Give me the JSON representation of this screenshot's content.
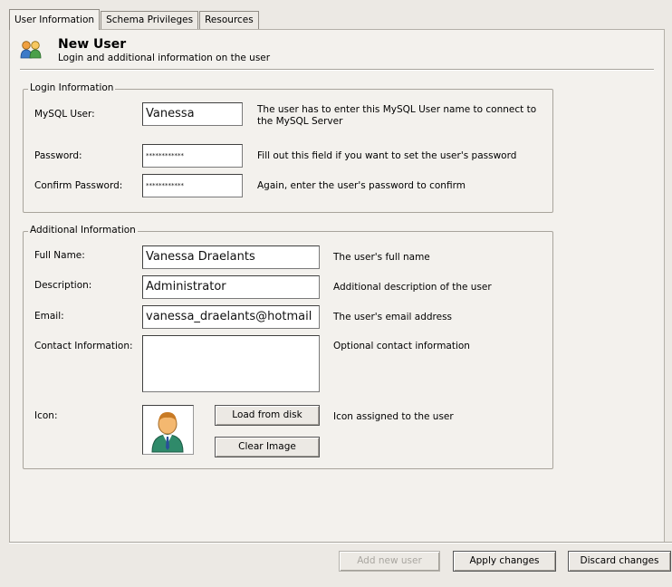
{
  "tabs": [
    {
      "label": "User Information"
    },
    {
      "label": "Schema Privileges"
    },
    {
      "label": "Resources"
    }
  ],
  "header": {
    "icon": "users-icon",
    "title": "New User",
    "subtitle": "Login and additional information on the user"
  },
  "login_group": {
    "title": "Login Information",
    "mysql_user": {
      "label": "MySQL User:",
      "value": "Vanessa",
      "hint": "The user has to enter this MySQL User name to connect to the MySQL Server"
    },
    "password": {
      "label": "Password:",
      "value": "************",
      "hint": "Fill out this field if you want to set the user's password"
    },
    "confirm_password": {
      "label": "Confirm Password:",
      "value": "************",
      "hint": "Again, enter the user's password to confirm"
    }
  },
  "additional_group": {
    "title": "Additional Information",
    "full_name": {
      "label": "Full Name:",
      "value": "Vanessa Draelants",
      "hint": "The user's full name"
    },
    "description": {
      "label": "Description:",
      "value": "Administrator",
      "hint": "Additional description of the user"
    },
    "email": {
      "label": "Email:",
      "value": "vanessa_draelants@hotmail",
      "hint": "The user's email address"
    },
    "contact": {
      "label": "Contact Information:",
      "value": "",
      "hint": "Optional contact information"
    },
    "icon": {
      "label": "Icon:",
      "load_button": "Load from disk",
      "clear_button": "Clear Image",
      "hint": "Icon assigned to the user",
      "image": "user-avatar-icon"
    }
  },
  "footer": {
    "add_new_user": "Add new user",
    "apply_changes": "Apply changes",
    "discard_changes": "Discard changes"
  }
}
